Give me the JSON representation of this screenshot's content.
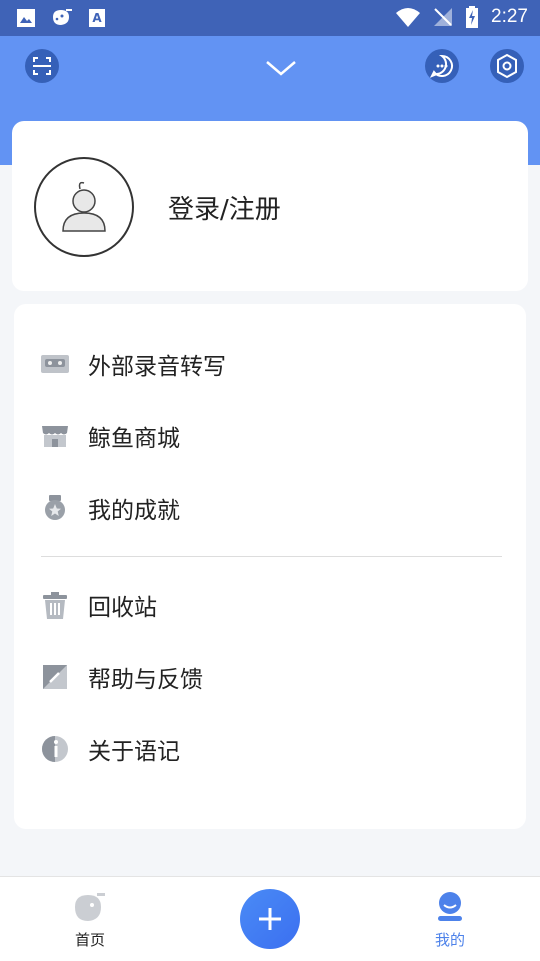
{
  "status_bar": {
    "time": "2:27"
  },
  "profile": {
    "login_label": "登录/注册"
  },
  "menu": {
    "group1": [
      {
        "label": "外部录音转写",
        "icon": "cassette-icon"
      },
      {
        "label": "鲸鱼商城",
        "icon": "store-icon"
      },
      {
        "label": "我的成就",
        "icon": "medal-icon"
      }
    ],
    "group2": [
      {
        "label": "回收站",
        "icon": "trash-icon"
      },
      {
        "label": "帮助与反馈",
        "icon": "feedback-edit-icon"
      },
      {
        "label": "关于语记",
        "icon": "info-icon"
      }
    ]
  },
  "bottom_nav": {
    "tabs": [
      {
        "label": "首页",
        "icon": "whale-home-icon",
        "active": false
      },
      {
        "label": "我的",
        "icon": "person-icon",
        "active": true
      }
    ],
    "add_icon": "plus-icon"
  },
  "colors": {
    "status_bar": "#3f63b7",
    "header": "#6293f3",
    "accent": "#3b6ff0",
    "active_tab": "#4d82ea"
  }
}
